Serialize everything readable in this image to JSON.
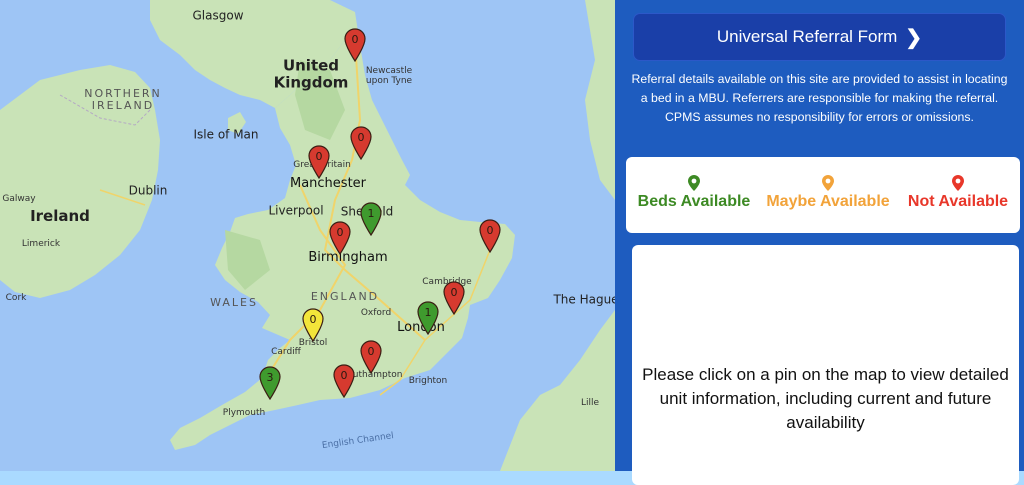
{
  "map": {
    "labels": [
      {
        "id": "glasgow",
        "text": "Glasgow",
        "cls": "city"
      },
      {
        "id": "uk",
        "text": "United\nKingdom",
        "cls": "country"
      },
      {
        "id": "newcastle",
        "text": "Newcastle\nupon Tyne",
        "cls": "small"
      },
      {
        "id": "ni",
        "text": "NORTHERN\nIRELAND",
        "cls": "region"
      },
      {
        "id": "iom",
        "text": "Isle of Man",
        "cls": "city"
      },
      {
        "id": "gb",
        "text": "Great Britain",
        "cls": "small"
      },
      {
        "id": "manchester",
        "text": "Manchester",
        "cls": "bigcity"
      },
      {
        "id": "dublin",
        "text": "Dublin",
        "cls": "city"
      },
      {
        "id": "galway",
        "text": "Galway",
        "cls": "small"
      },
      {
        "id": "ireland",
        "text": "Ireland",
        "cls": "country"
      },
      {
        "id": "liverpool",
        "text": "Liverpool",
        "cls": "city"
      },
      {
        "id": "sheffield",
        "text": "Sheffield",
        "cls": "city"
      },
      {
        "id": "limerick",
        "text": "Limerick",
        "cls": "small"
      },
      {
        "id": "birmingham",
        "text": "Birmingham",
        "cls": "bigcity"
      },
      {
        "id": "cambridge",
        "text": "Cambridge",
        "cls": "small"
      },
      {
        "id": "wales",
        "text": "WALES",
        "cls": "region"
      },
      {
        "id": "england",
        "text": "ENGLAND",
        "cls": "region"
      },
      {
        "id": "oxford",
        "text": "Oxford",
        "cls": "small"
      },
      {
        "id": "cork",
        "text": "Cork",
        "cls": "small"
      },
      {
        "id": "london",
        "text": "London",
        "cls": "bigcity"
      },
      {
        "id": "bristol",
        "text": "Bristol",
        "cls": "small"
      },
      {
        "id": "cardiff",
        "text": "Cardiff",
        "cls": "small"
      },
      {
        "id": "southampton",
        "text": "Southampton",
        "cls": "small"
      },
      {
        "id": "brighton",
        "text": "Brighton",
        "cls": "small"
      },
      {
        "id": "plymouth",
        "text": "Plymouth",
        "cls": "small"
      },
      {
        "id": "channel",
        "text": "English Channel",
        "cls": "water"
      },
      {
        "id": "hague",
        "text": "The Hague",
        "cls": "city"
      },
      {
        "id": "lille",
        "text": "Lille",
        "cls": "small"
      }
    ],
    "pins": [
      {
        "id": "newcastle",
        "count": "0",
        "status": "not_available"
      },
      {
        "id": "leeds",
        "count": "0",
        "status": "not_available"
      },
      {
        "id": "manchester",
        "count": "0",
        "status": "not_available"
      },
      {
        "id": "sheffield",
        "count": "1",
        "status": "beds_available"
      },
      {
        "id": "norwich",
        "count": "0",
        "status": "not_available"
      },
      {
        "id": "birmingham",
        "count": "0",
        "status": "not_available"
      },
      {
        "id": "chelmsford",
        "count": "0",
        "status": "not_available"
      },
      {
        "id": "london",
        "count": "1",
        "status": "beds_available"
      },
      {
        "id": "bristol",
        "count": "0",
        "status": "maybe_available"
      },
      {
        "id": "winchester",
        "count": "0",
        "status": "not_available"
      },
      {
        "id": "southampton",
        "count": "0",
        "status": "not_available"
      },
      {
        "id": "exeter",
        "count": "3",
        "status": "beds_available"
      }
    ]
  },
  "colors": {
    "beds_available": "#3d8a24",
    "maybe_available": "#f2a33a",
    "not_available": "#e8372a",
    "pin_beds": "#3f9a2e",
    "pin_maybe": "#f3e53a",
    "pin_not": "#d63a2f",
    "panel_bg": "#1e5cbf",
    "button_bg": "#1a3fa8"
  },
  "panel": {
    "form_button": {
      "label": "Universal Referral Form",
      "icon": "chevron-right-icon"
    },
    "disclaimer": "Referral details available on this site are provided to assist in locating a bed in a MBU. Referrers are responsible for making the referral. CPMS assumes no responsibility for errors or omissions.",
    "legend": [
      {
        "key": "beds_available",
        "label": "Beds Available"
      },
      {
        "key": "maybe_available",
        "label": "Maybe Available"
      },
      {
        "key": "not_available",
        "label": "Not Available"
      }
    ],
    "info_text": "Please click on a pin on the map to view detailed unit information, including current and future availability"
  }
}
